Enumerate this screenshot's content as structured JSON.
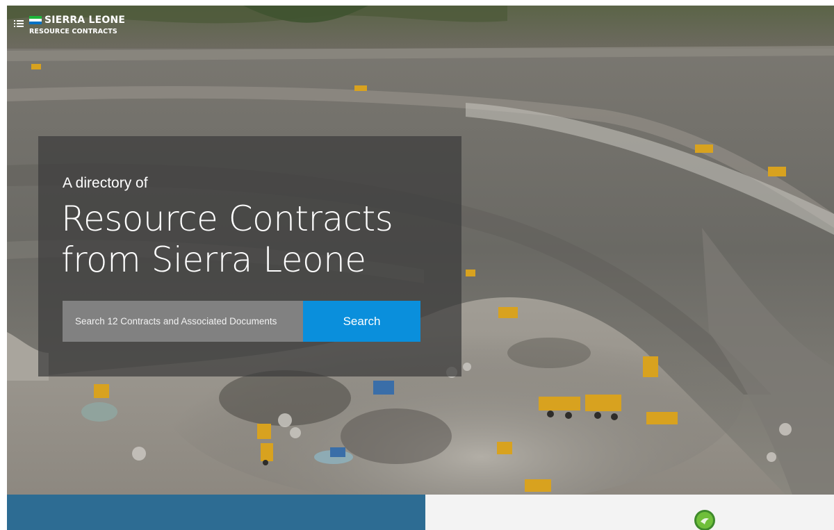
{
  "brand": {
    "title": "SIERRA LEONE",
    "subtitle": "RESOURCE CONTRACTS",
    "flag_colors": [
      "#1eb53a",
      "#ffffff",
      "#0072c6"
    ],
    "menu_icon": "menu-icon"
  },
  "hero": {
    "intro": "A directory of",
    "title": "Resource Contracts from Sierra Leone",
    "search": {
      "placeholder": "Search 12 Contracts and Associated Documents",
      "value": "",
      "button_label": "Search"
    }
  },
  "colors": {
    "accent": "#0a8fdc",
    "panel_blue": "#2d6c93",
    "panel_light": "#f3f3f3"
  },
  "bottom": {
    "right_icon": "globe-icon"
  }
}
